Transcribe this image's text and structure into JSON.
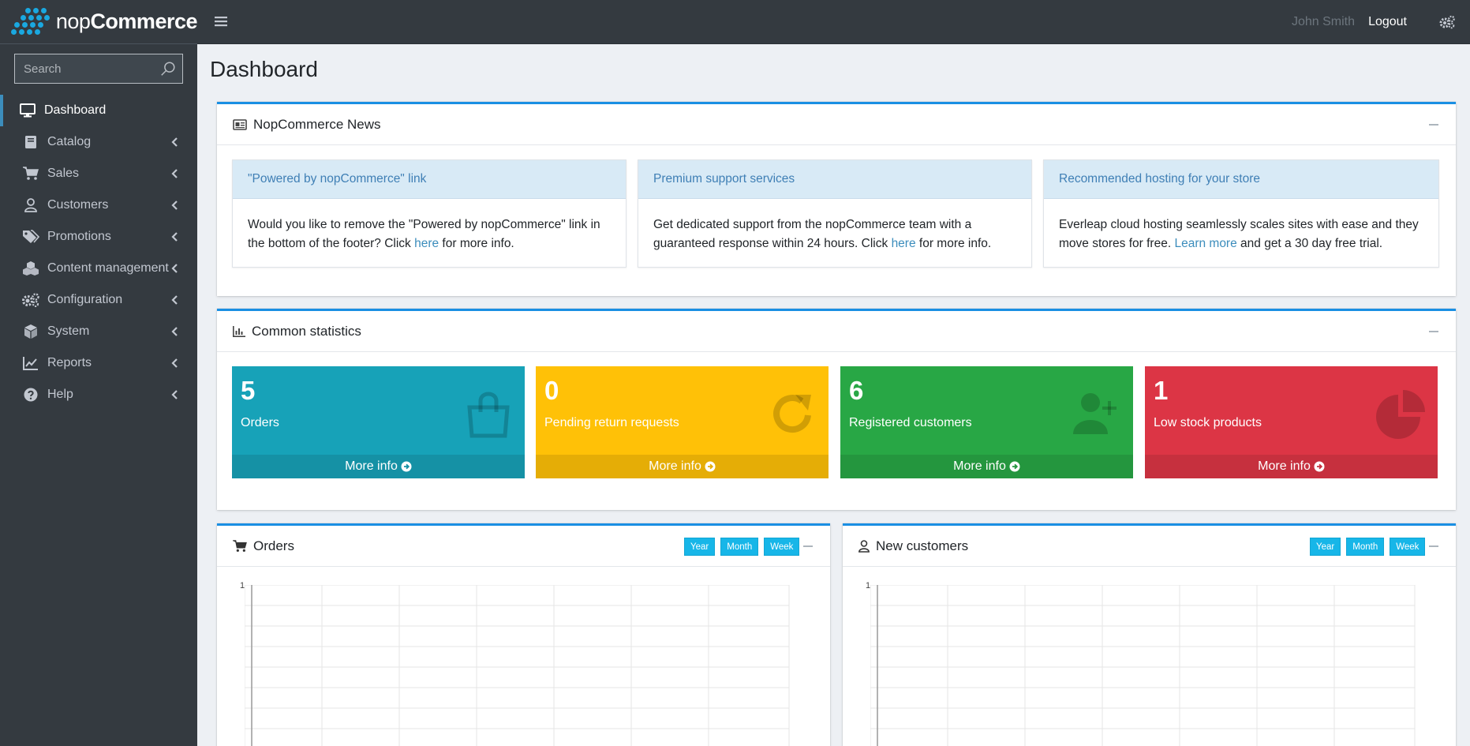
{
  "brand": {
    "name_light": "nop",
    "name_bold": "Commerce"
  },
  "sidebar": {
    "search_placeholder": "Search",
    "items": [
      {
        "label": "Dashboard",
        "icon": "monitor-icon",
        "active": true
      },
      {
        "label": "Catalog",
        "icon": "book-icon"
      },
      {
        "label": "Sales",
        "icon": "cart-icon"
      },
      {
        "label": "Customers",
        "icon": "user-icon"
      },
      {
        "label": "Promotions",
        "icon": "tags-icon"
      },
      {
        "label": "Content management",
        "icon": "cubes-icon"
      },
      {
        "label": "Configuration",
        "icon": "gears-icon"
      },
      {
        "label": "System",
        "icon": "cube-icon"
      },
      {
        "label": "Reports",
        "icon": "line-chart-icon"
      },
      {
        "label": "Help",
        "icon": "question-circle-icon"
      }
    ]
  },
  "header": {
    "user": "John Smith",
    "logout": "Logout"
  },
  "page_title": "Dashboard",
  "news": {
    "title": "NopCommerce News",
    "items": [
      {
        "title": "\"Powered by nopCommerce\" link",
        "body_before": "Would you like to remove the \"Powered by nopCommerce\" link in the bottom of the footer? Click ",
        "link": "here",
        "body_after": " for more info."
      },
      {
        "title": "Premium support services",
        "body_before": "Get dedicated support from the nopCommerce team with a guaranteed response within 24 hours. Click ",
        "link": "here",
        "body_after": " for more info."
      },
      {
        "title": "Recommended hosting for your store",
        "body_before": "Everleap cloud hosting seamlessly scales sites with ease and they move stores for free. ",
        "link": "Learn more",
        "body_after": " and get a 30 day free trial."
      }
    ]
  },
  "stats": {
    "title": "Common statistics",
    "more_info": "More info",
    "items": [
      {
        "value": "5",
        "label": "Orders",
        "color": "#17a2b8",
        "footer_color": "#1591a5",
        "icon": "shopping-bag-icon"
      },
      {
        "value": "0",
        "label": "Pending return requests",
        "color": "#ffc107",
        "footer_color": "#e5ad06",
        "icon": "refresh-icon"
      },
      {
        "value": "6",
        "label": "Registered customers",
        "color": "#28a745",
        "footer_color": "#24963e",
        "icon": "user-plus-icon"
      },
      {
        "value": "1",
        "label": "Low stock products",
        "color": "#dc3545",
        "footer_color": "#c6303e",
        "icon": "pie-chart-icon"
      }
    ]
  },
  "orders_chart": {
    "title": "Orders",
    "buttons": [
      "Year",
      "Month",
      "Week"
    ],
    "y_max_label": "1"
  },
  "customers_chart": {
    "title": "New customers",
    "buttons": [
      "Year",
      "Month",
      "Week"
    ],
    "y_max_label": "1"
  }
}
